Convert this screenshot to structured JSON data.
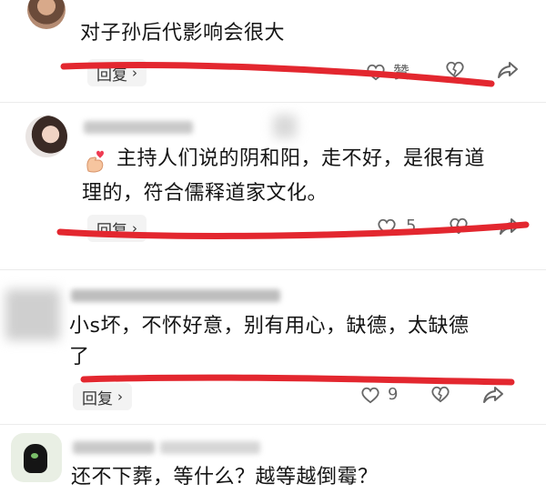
{
  "comments": [
    {
      "text_lines": [
        "对子孙后代影响会很大"
      ],
      "reply_label": "回复",
      "like_label": "赞",
      "like_count": ""
    },
    {
      "text_lines": [
        "主持人们说的阴和阳，走不好，是很有道",
        "理的，符合儒释道家文化。"
      ],
      "reply_label": "回复",
      "like_count": "5"
    },
    {
      "text_lines": [
        "小s坏，不怀好意，别有用心，缺德，太缺德",
        "了"
      ],
      "reply_label": "回复",
      "like_count": "9"
    },
    {
      "text_lines": [
        "还不下葬，等什么？越等越倒霉？"
      ]
    }
  ],
  "icons": {
    "like": "heart-outline-icon",
    "dislike": "broken-heart-icon",
    "share": "share-arrow-icon",
    "chevron": "chevron-right-icon",
    "emoji": "finger-heart-emoji-icon"
  },
  "colors": {
    "annotation_red": "#e3272f",
    "text": "#151515",
    "icon_gray": "#666666"
  }
}
